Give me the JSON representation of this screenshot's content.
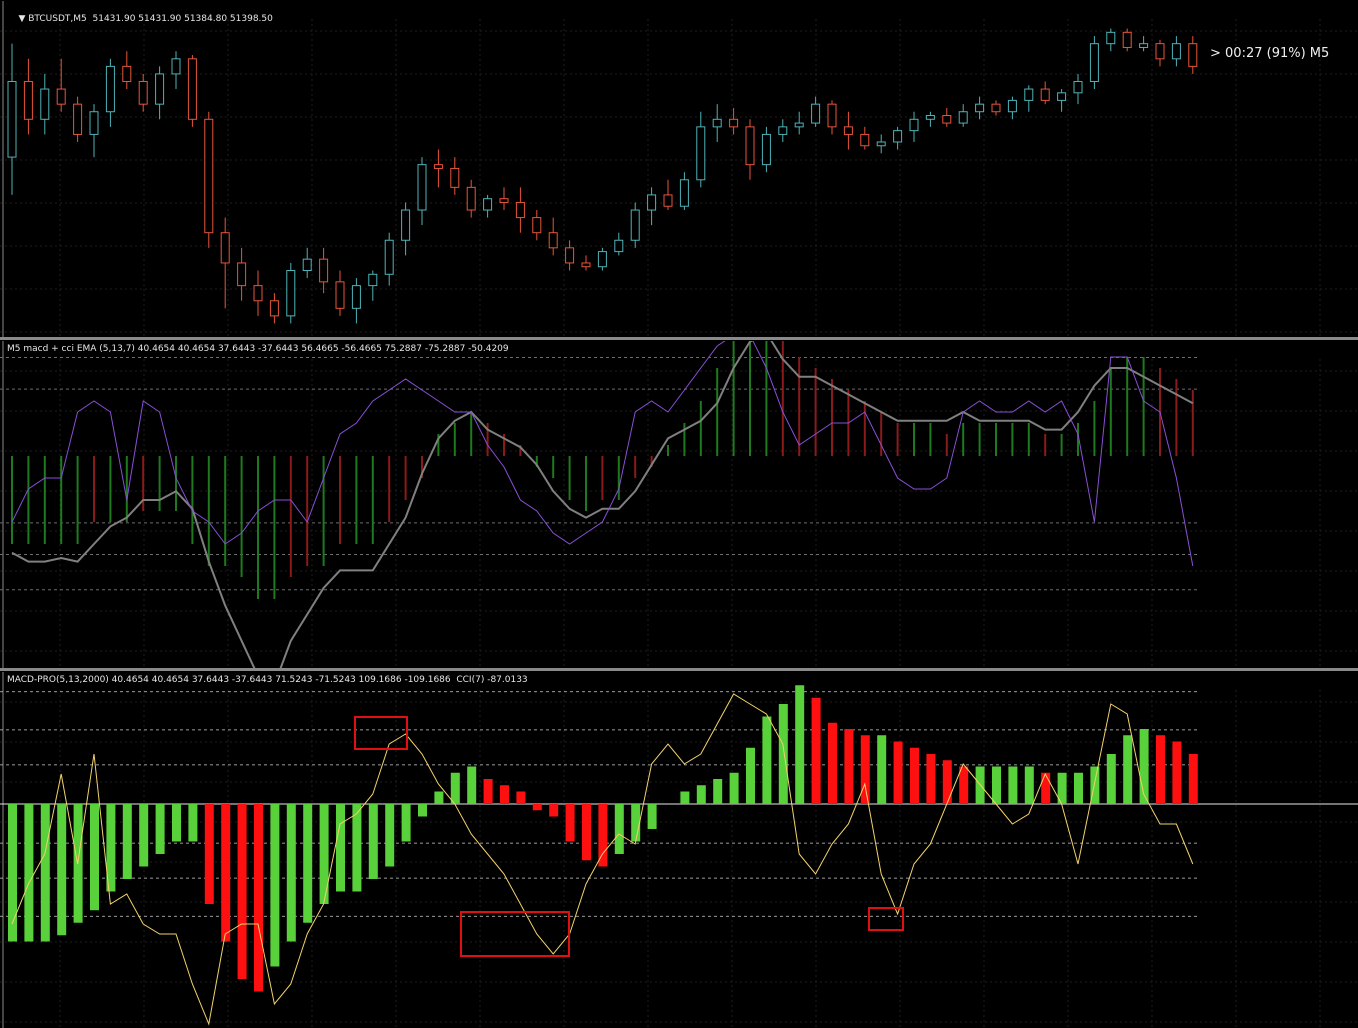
{
  "window": {
    "symbol_title": "BTCUSDT,M5",
    "ohlc_text": "51431.90 51431.90 51384.80 51398.50",
    "timer_text": "> 00:27 (91%) M5"
  },
  "indicator1": {
    "title": "M5 macd + cci EMA (5,13,7) 40.4654 40.4654 37.6443 -37.6443 56.4665 -56.4665 75.2887 -75.2887 -50.4209"
  },
  "indicator2": {
    "title": "MACD-PRO(5,13,2000) 40.4654 40.4654 37.6443 -37.6443 71.5243 -71.5243 109.1686 -109.1686  CCI(7) -87.0133"
  },
  "colors": {
    "bull_candle": "#4fb3b8",
    "bear_candle": "#e8553a",
    "hist_green_dark": "#1f7a1f",
    "hist_red_dark": "#8b1a1a",
    "hist_green_bright": "#59d13a",
    "hist_red_bright": "#ff1010",
    "signal_gray": "#808080",
    "cci_purple": "#8a4fd6",
    "cci_yellow": "#f2d26b",
    "highlight_box": "#e01010"
  },
  "chart_data": [
    {
      "type": "candlestick",
      "series": [
        {
          "name": "BTCUSDT,M5",
          "ohlc": [
            [
              51300,
              51450,
              51250,
              51400
            ],
            [
              51400,
              51430,
              51330,
              51350
            ],
            [
              51350,
              51410,
              51330,
              51390
            ],
            [
              51390,
              51430,
              51360,
              51370
            ],
            [
              51370,
              51380,
              51320,
              51330
            ],
            [
              51330,
              51370,
              51300,
              51360
            ],
            [
              51360,
              51430,
              51340,
              51420
            ],
            [
              51420,
              51440,
              51390,
              51400
            ],
            [
              51400,
              51410,
              51360,
              51370
            ],
            [
              51370,
              51420,
              51350,
              51410
            ],
            [
              51410,
              51440,
              51390,
              51430
            ],
            [
              51430,
              51435,
              51340,
              51350
            ],
            [
              51350,
              51360,
              51180,
              51200
            ],
            [
              51200,
              51220,
              51100,
              51160
            ],
            [
              51160,
              51180,
              51110,
              51130
            ],
            [
              51130,
              51150,
              51090,
              51110
            ],
            [
              51110,
              51120,
              51080,
              51090
            ],
            [
              51090,
              51160,
              51080,
              51150
            ],
            [
              51150,
              51180,
              51140,
              51165
            ],
            [
              51165,
              51180,
              51120,
              51135
            ],
            [
              51135,
              51150,
              51090,
              51100
            ],
            [
              51100,
              51140,
              51080,
              51130
            ],
            [
              51130,
              51150,
              51110,
              51145
            ],
            [
              51145,
              51200,
              51130,
              51190
            ],
            [
              51190,
              51240,
              51170,
              51230
            ],
            [
              51230,
              51300,
              51210,
              51290
            ],
            [
              51290,
              51310,
              51260,
              51285
            ],
            [
              51285,
              51300,
              51250,
              51260
            ],
            [
              51260,
              51270,
              51220,
              51230
            ],
            [
              51230,
              51250,
              51220,
              51245
            ],
            [
              51245,
              51260,
              51230,
              51240
            ],
            [
              51240,
              51260,
              51200,
              51220
            ],
            [
              51220,
              51230,
              51190,
              51200
            ],
            [
              51200,
              51220,
              51170,
              51180
            ],
            [
              51180,
              51190,
              51150,
              51160
            ],
            [
              51160,
              51170,
              51150,
              51155
            ],
            [
              51155,
              51180,
              51150,
              51175
            ],
            [
              51175,
              51200,
              51170,
              51190
            ],
            [
              51190,
              51240,
              51180,
              51230
            ],
            [
              51230,
              51260,
              51210,
              51250
            ],
            [
              51250,
              51270,
              51230,
              51235
            ],
            [
              51235,
              51280,
              51230,
              51270
            ],
            [
              51270,
              51360,
              51260,
              51340
            ],
            [
              51340,
              51370,
              51320,
              51350
            ],
            [
              51350,
              51365,
              51330,
              51340
            ],
            [
              51340,
              51350,
              51270,
              51290
            ],
            [
              51290,
              51340,
              51280,
              51330
            ],
            [
              51330,
              51350,
              51320,
              51340
            ],
            [
              51340,
              51360,
              51330,
              51345
            ],
            [
              51345,
              51380,
              51340,
              51370
            ],
            [
              51370,
              51375,
              51330,
              51340
            ],
            [
              51340,
              51360,
              51310,
              51330
            ],
            [
              51330,
              51340,
              51310,
              51315
            ],
            [
              51315,
              51330,
              51305,
              51320
            ],
            [
              51320,
              51340,
              51310,
              51335
            ],
            [
              51335,
              51360,
              51320,
              51350
            ],
            [
              51350,
              51360,
              51340,
              51355
            ],
            [
              51355,
              51365,
              51340,
              51345
            ],
            [
              51345,
              51370,
              51340,
              51360
            ],
            [
              51360,
              51380,
              51350,
              51370
            ],
            [
              51370,
              51375,
              51355,
              51360
            ],
            [
              51360,
              51380,
              51350,
              51375
            ],
            [
              51375,
              51395,
              51360,
              51390
            ],
            [
              51390,
              51400,
              51370,
              51375
            ],
            [
              51375,
              51390,
              51360,
              51385
            ],
            [
              51385,
              51410,
              51370,
              51400
            ],
            [
              51400,
              51460,
              51390,
              51450
            ],
            [
              51450,
              51470,
              51440,
              51465
            ],
            [
              51465,
              51470,
              51440,
              51445
            ],
            [
              51445,
              51460,
              51440,
              51450
            ],
            [
              51450,
              51455,
              51420,
              51430
            ],
            [
              51430,
              51460,
              51420,
              51450
            ],
            [
              51450,
              51460,
              51410,
              51420
            ]
          ]
        }
      ]
    },
    {
      "type": "bar",
      "title": "M5 macd + cci EMA (5,13,7)",
      "series": [
        {
          "name": "histogram",
          "values": [
            -40,
            -40,
            -40,
            -40,
            -40,
            -30,
            -30,
            -30,
            -25,
            -25,
            -25,
            -40,
            -50,
            -50,
            -55,
            -65,
            -65,
            -55,
            -50,
            -50,
            -40,
            -40,
            -40,
            -30,
            -20,
            -10,
            10,
            15,
            20,
            15,
            10,
            5,
            -5,
            -10,
            -20,
            -25,
            -20,
            -20,
            -10,
            -5,
            5,
            15,
            25,
            40,
            55,
            60,
            65,
            55,
            45,
            40,
            35,
            30,
            25,
            20,
            15,
            15,
            15,
            10,
            15,
            15,
            15,
            15,
            15,
            10,
            10,
            15,
            25,
            40,
            45,
            45,
            40,
            35,
            30
          ]
        },
        {
          "name": "signal",
          "values": [
            -55,
            -60,
            -60,
            -58,
            -60,
            -50,
            -40,
            -35,
            -25,
            -25,
            -20,
            -30,
            -60,
            -85,
            -105,
            -125,
            -130,
            -105,
            -90,
            -75,
            -65,
            -65,
            -65,
            -50,
            -35,
            -10,
            10,
            20,
            25,
            15,
            10,
            5,
            -5,
            -20,
            -30,
            -35,
            -30,
            -30,
            -20,
            -5,
            10,
            15,
            20,
            30,
            50,
            65,
            70,
            55,
            45,
            45,
            40,
            35,
            30,
            25,
            20,
            20,
            20,
            20,
            25,
            20,
            20,
            20,
            20,
            15,
            15,
            25,
            40,
            50,
            50,
            45,
            40,
            35,
            30
          ]
        },
        {
          "name": "cci",
          "values": [
            -30,
            -15,
            -10,
            -10,
            20,
            25,
            20,
            -20,
            25,
            20,
            -10,
            -25,
            -30,
            -40,
            -35,
            -25,
            -20,
            -20,
            -30,
            -10,
            10,
            15,
            25,
            30,
            35,
            30,
            25,
            20,
            20,
            5,
            -5,
            -20,
            -25,
            -35,
            -40,
            -35,
            -30,
            -15,
            20,
            25,
            20,
            30,
            40,
            50,
            55,
            55,
            40,
            20,
            5,
            10,
            15,
            15,
            20,
            5,
            -10,
            -15,
            -15,
            -10,
            20,
            25,
            20,
            20,
            25,
            20,
            25,
            10,
            -30,
            45,
            45,
            25,
            20,
            -10,
            -50
          ]
        }
      ]
    },
    {
      "type": "bar",
      "title": "MACD-PRO(5,13,2000)",
      "series": [
        {
          "name": "histogram",
          "values": [
            -110,
            -110,
            -110,
            -105,
            -95,
            -85,
            -70,
            -60,
            -50,
            -40,
            -30,
            -30,
            -80,
            -110,
            -140,
            -150,
            -130,
            -110,
            -95,
            -80,
            -70,
            -70,
            -60,
            -50,
            -30,
            -10,
            10,
            25,
            30,
            20,
            15,
            10,
            -5,
            -10,
            -30,
            -45,
            -50,
            -40,
            -30,
            -20,
            0,
            10,
            15,
            20,
            25,
            45,
            70,
            80,
            95,
            85,
            65,
            60,
            55,
            55,
            50,
            45,
            40,
            35,
            30,
            30,
            30,
            30,
            30,
            25,
            25,
            25,
            30,
            40,
            55,
            60,
            55,
            50,
            40
          ]
        },
        {
          "name": "cci",
          "values": [
            -120,
            -80,
            -50,
            30,
            -60,
            50,
            -100,
            -90,
            -120,
            -130,
            -130,
            -180,
            -220,
            -130,
            -120,
            -120,
            -200,
            -180,
            -130,
            -100,
            -20,
            -10,
            10,
            60,
            70,
            50,
            20,
            0,
            -30,
            -50,
            -70,
            -100,
            -130,
            -150,
            -130,
            -80,
            -50,
            -30,
            -40,
            40,
            60,
            40,
            50,
            80,
            110,
            100,
            90,
            60,
            -50,
            -70,
            -40,
            -20,
            20,
            -70,
            -110,
            -60,
            -40,
            0,
            40,
            20,
            0,
            -20,
            -10,
            30,
            0,
            -60,
            20,
            100,
            90,
            10,
            -20,
            -20,
            -60
          ]
        },
        {
          "name": "highlight",
          "values": []
        }
      ]
    }
  ]
}
